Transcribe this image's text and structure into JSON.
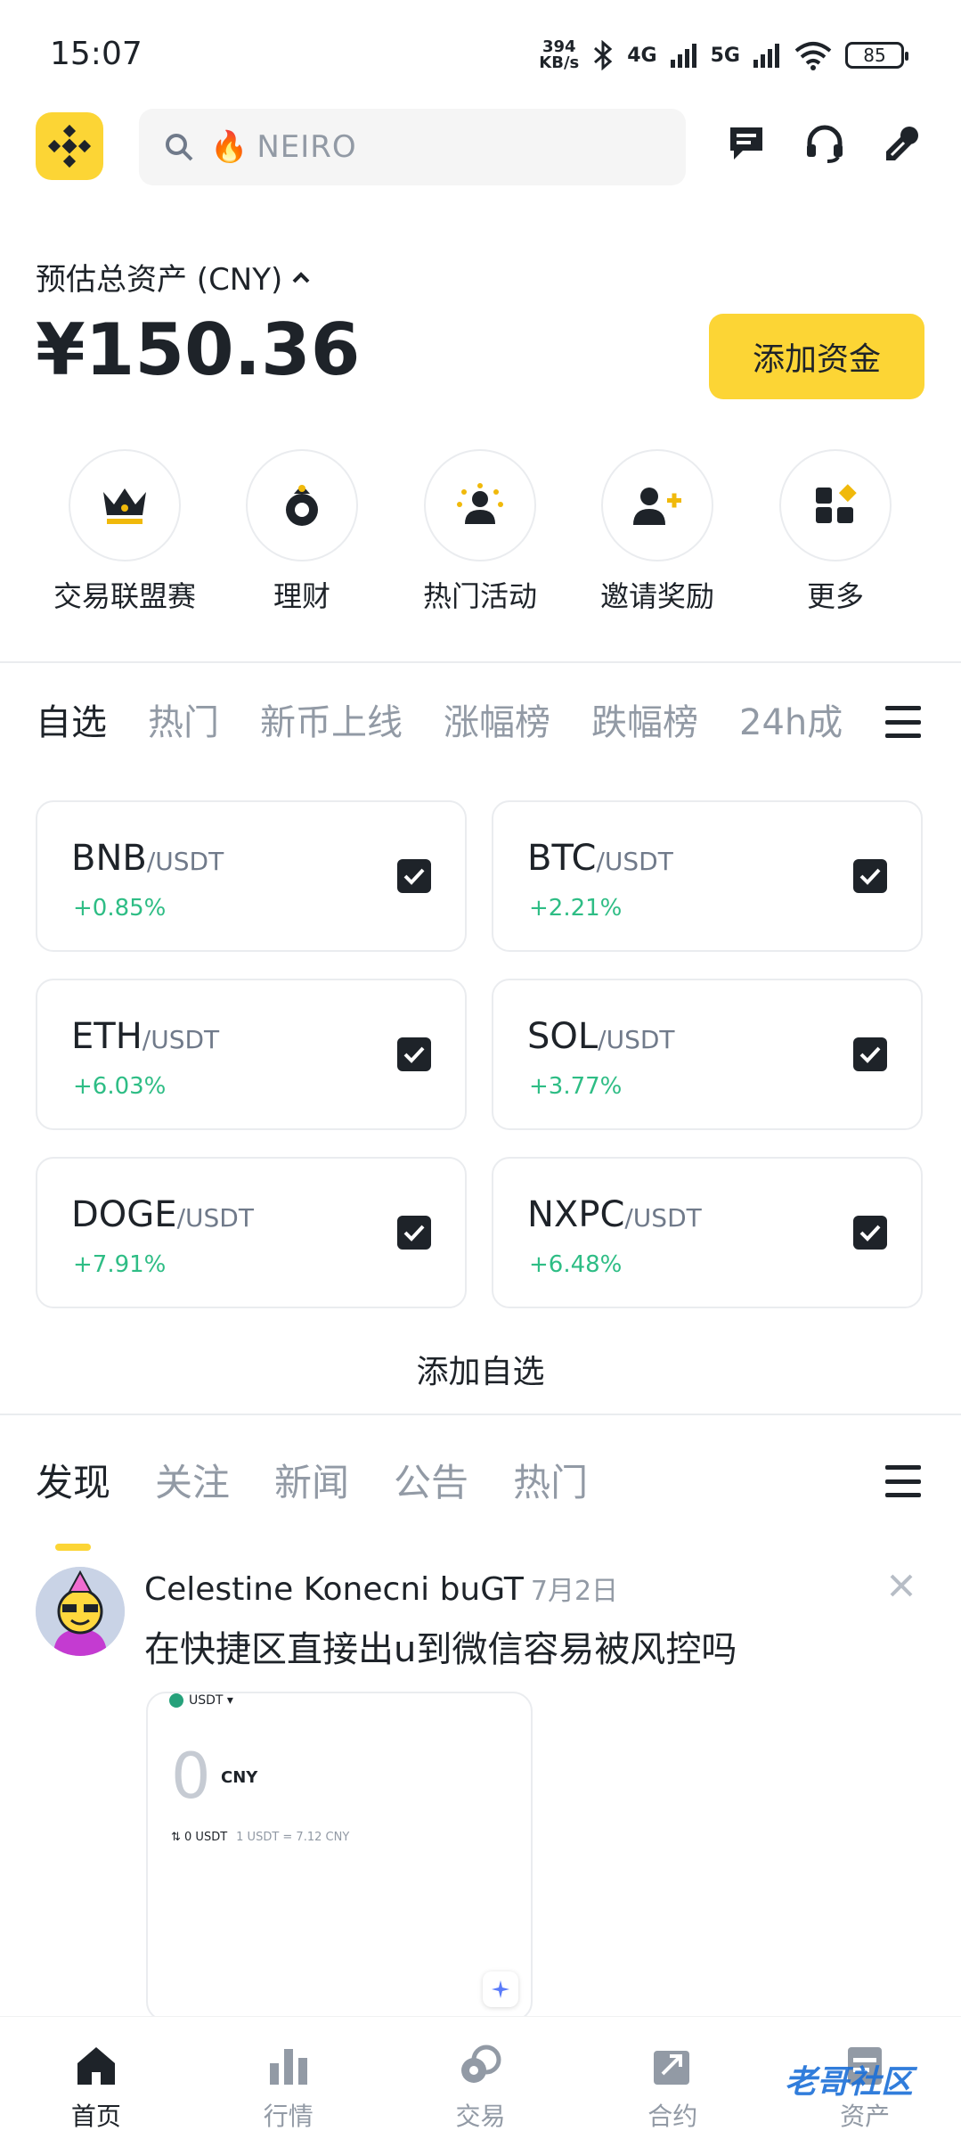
{
  "status_bar": {
    "time": "15:07",
    "net_speed_value": "394",
    "net_speed_unit": "KB/s",
    "sig_4g": "4G",
    "sig_5g": "5G",
    "battery": "85"
  },
  "search": {
    "placeholder": "NEIRO"
  },
  "assets": {
    "label": "预估总资产 (CNY)",
    "value": "¥150.36",
    "add_funds": "添加资金"
  },
  "shortcuts": [
    {
      "label": "交易联盟赛",
      "icon": "crown-icon"
    },
    {
      "label": "理财",
      "icon": "savings-icon"
    },
    {
      "label": "热门活动",
      "icon": "event-icon"
    },
    {
      "label": "邀请奖励",
      "icon": "invite-icon"
    },
    {
      "label": "更多",
      "icon": "more-icon"
    }
  ],
  "market_tabs": [
    "自选",
    "热门",
    "新币上线",
    "涨幅榜",
    "跌幅榜",
    "24h成"
  ],
  "pairs": [
    {
      "base": "BNB",
      "quote": "/USDT",
      "change": "+0.85%"
    },
    {
      "base": "BTC",
      "quote": "/USDT",
      "change": "+2.21%"
    },
    {
      "base": "ETH",
      "quote": "/USDT",
      "change": "+6.03%"
    },
    {
      "base": "SOL",
      "quote": "/USDT",
      "change": "+3.77%"
    },
    {
      "base": "DOGE",
      "quote": "/USDT",
      "change": "+7.91%"
    },
    {
      "base": "NXPC",
      "quote": "/USDT",
      "change": "+6.48%"
    }
  ],
  "add_watchlist": "添加自选",
  "feed_tabs": [
    "发现",
    "关注",
    "新闻",
    "公告",
    "热门"
  ],
  "post": {
    "author": "Celestine Konecni buGT",
    "date": "7月2日",
    "text": "在快捷区直接出u到微信容易被风控吗",
    "image": {
      "currency": "USDT ▾",
      "amount": "0",
      "unit": "CNY",
      "usdt_line": "⇅ 0 USDT",
      "rate": "1 USDT = 7.12 CNY"
    }
  },
  "bottom_nav": [
    {
      "label": "首页",
      "icon": "home-icon"
    },
    {
      "label": "行情",
      "icon": "markets-icon"
    },
    {
      "label": "交易",
      "icon": "trade-icon"
    },
    {
      "label": "合约",
      "icon": "futures-icon"
    },
    {
      "label": "资产",
      "icon": "wallet-icon"
    }
  ],
  "watermark": "老哥社区",
  "colors": {
    "brand": "#fcd535",
    "up": "#2ebd85",
    "text": "#1e2329",
    "muted": "#929aa5"
  }
}
